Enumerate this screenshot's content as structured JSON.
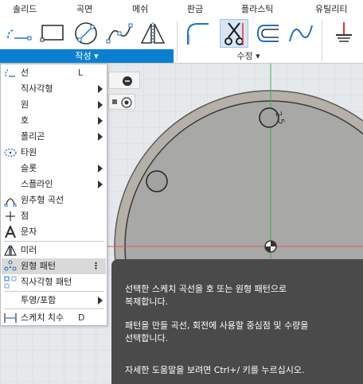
{
  "ribbon": {
    "tabs": [
      "솔리드",
      "곡면",
      "메쉬",
      "판금",
      "플라스틱",
      "유틸리티"
    ],
    "groups": {
      "create_label": "작성 ▾",
      "modify_label": "수정 ▾"
    }
  },
  "menu": {
    "items": [
      {
        "label": "선",
        "shortcut": "L",
        "icon": "line-icon"
      },
      {
        "label": "직사각형",
        "submenu": true
      },
      {
        "label": "원",
        "submenu": true
      },
      {
        "label": "호",
        "submenu": true
      },
      {
        "label": "폴리곤",
        "submenu": true
      },
      {
        "label": "타원",
        "icon": "ellipse-icon"
      },
      {
        "label": "슬롯",
        "submenu": true
      },
      {
        "label": "스플라인",
        "submenu": true
      },
      {
        "label": "원추형 곡선",
        "icon": "conic-curve-icon"
      },
      {
        "label": "점",
        "icon": "point-icon"
      },
      {
        "label": "문자",
        "icon": "text-icon"
      },
      {
        "label": "미러",
        "icon": "mirror-icon"
      },
      {
        "label": "원형 패턴",
        "icon": "circular-pattern-icon",
        "highlighted": true,
        "more": "⋮"
      },
      {
        "label": "직사각형 패턴",
        "icon": "rectangular-pattern-icon"
      },
      {
        "label": "투영/포함",
        "submenu": true
      },
      {
        "label": "스케치 치수",
        "shortcut": "D",
        "icon": "sketch-dimension-icon"
      }
    ]
  },
  "tooltip": {
    "line1": "선택한 스케치 곡선을 호 또는 원형 패턴으로",
    "line2": "복제합니다.",
    "line3": "패턴을 만들 곡선, 회전에 사용할 중심점 및 수량을",
    "line4": "선택합니다.",
    "line5": "자세한 도움말을 보려면 Ctrl+/ 키를 누르십시오."
  },
  "canvas": {
    "dimension_text": "2.5"
  },
  "colors": {
    "accent": "#0b7fd0",
    "tooltip_bg": "#4a4a4a",
    "axis_green": "#39b54a",
    "axis_red": "#e05a5a"
  }
}
